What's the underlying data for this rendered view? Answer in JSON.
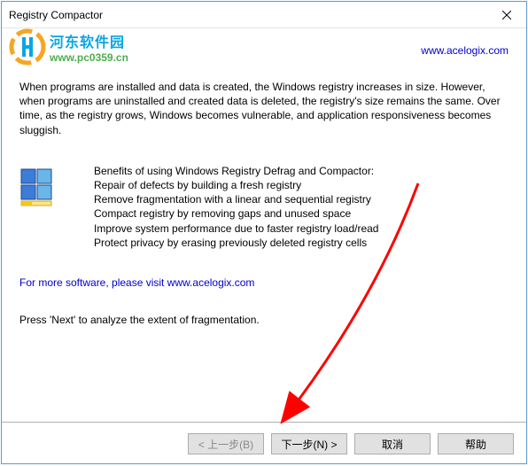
{
  "window": {
    "title": "Registry Compactor"
  },
  "watermark": {
    "title": "河东软件园",
    "url": "www.pc0359.cn"
  },
  "header_link": "www.acelogix.com",
  "intro_text": "When programs are installed and data is created, the Windows registry increases in size. However, when programs are uninstalled and created data is deleted, the registry's size remains the same. Over time, as the registry grows, Windows becomes vulnerable, and application responsiveness becomes sluggish.",
  "benefits": {
    "heading": "Benefits of using Windows Registry Defrag and Compactor:",
    "items": [
      "Repair of defects by building a fresh registry",
      "Remove fragmentation with a linear and sequential registry",
      "Compact registry by removing gaps and unused space",
      "Improve system performance due to faster registry load/read",
      "Protect privacy by erasing previously deleted registry cells"
    ]
  },
  "more_software": "For more software, please visit www.acelogix.com",
  "press_next": "Press 'Next' to analyze the extent of fragmentation.",
  "buttons": {
    "back": "< 上一步(B)",
    "next": "下一步(N) >",
    "cancel": "取消",
    "help": "帮助"
  }
}
